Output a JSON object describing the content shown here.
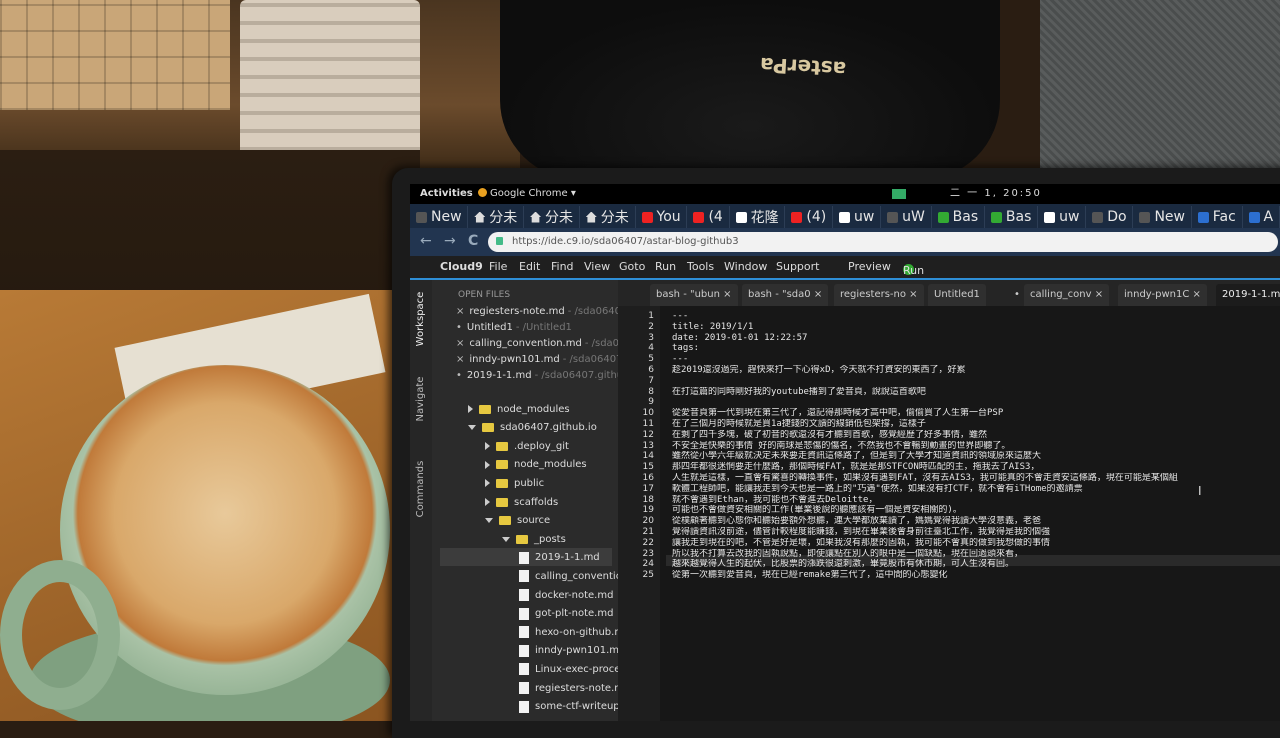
{
  "topbar": {
    "activities": "Activities",
    "app": "Google Chrome ▾",
    "clock": "二 一  1, 20:50"
  },
  "bag_logo": "asterPa",
  "browser_tabs": [
    {
      "icon": "doc-icon",
      "label": "New"
    },
    {
      "icon": "home-icon",
      "label": "分未"
    },
    {
      "icon": "home-icon",
      "label": "分未"
    },
    {
      "icon": "home-icon",
      "label": "分未"
    },
    {
      "icon": "youtube-icon",
      "label": "You"
    },
    {
      "icon": "youtube-icon",
      "label": "(4"
    },
    {
      "icon": "chrome-icon",
      "label": "花隆"
    },
    {
      "icon": "youtube-icon",
      "label": "(4)"
    },
    {
      "icon": "chrome-icon",
      "label": "uw"
    },
    {
      "icon": "doc-icon",
      "label": "uW"
    },
    {
      "icon": "sheet-icon",
      "label": "Bas"
    },
    {
      "icon": "sheet-icon",
      "label": "Bas"
    },
    {
      "icon": "chrome-icon",
      "label": "uw"
    },
    {
      "icon": "doc-icon",
      "label": "Do"
    },
    {
      "icon": "doc-icon",
      "label": "New"
    },
    {
      "icon": "facebook-icon",
      "label": "Fac"
    },
    {
      "icon": "blue-icon",
      "label": "A"
    }
  ],
  "address": {
    "back": "←",
    "forward": "→",
    "reload": "C",
    "url": "https://ide.c9.io/sda06407/astar-blog-github3"
  },
  "c9menu": {
    "logo": "Cloud9",
    "items": [
      "File",
      "Edit",
      "Find",
      "View",
      "Goto",
      "Run",
      "Tools",
      "Window",
      "Support"
    ],
    "preview": "Preview",
    "run": "Run"
  },
  "side_tabs": [
    "Workspace",
    "Navigate",
    "Commands"
  ],
  "open_files": {
    "header": "OPEN FILES",
    "files": [
      {
        "mark": "×",
        "name": "regiesters-note.md",
        "path": "- /sda06407.g"
      },
      {
        "mark": "•",
        "name": "Untitled1",
        "path": "- /Untitled1"
      },
      {
        "mark": "×",
        "name": "calling_convention.md",
        "path": "- /sda064"
      },
      {
        "mark": "×",
        "name": "inndy-pwn101.md",
        "path": "- /sda06407.gi"
      },
      {
        "mark": "•",
        "name": "2019-1-1.md",
        "path": "- /sda06407.github."
      }
    ]
  },
  "tree": [
    {
      "kind": "folder",
      "arrow": "right",
      "indent": 0,
      "name": "node_modules"
    },
    {
      "kind": "folder",
      "arrow": "down",
      "indent": 0,
      "name": "sda06407.github.io"
    },
    {
      "kind": "folder",
      "arrow": "right",
      "indent": 1,
      "name": ".deploy_git"
    },
    {
      "kind": "folder",
      "arrow": "right",
      "indent": 1,
      "name": "node_modules"
    },
    {
      "kind": "folder",
      "arrow": "right",
      "indent": 1,
      "name": "public"
    },
    {
      "kind": "folder",
      "arrow": "right",
      "indent": 1,
      "name": "scaffolds"
    },
    {
      "kind": "folder",
      "arrow": "down",
      "indent": 1,
      "name": "source"
    },
    {
      "kind": "folder",
      "arrow": "down",
      "indent": 2,
      "name": "_posts"
    },
    {
      "kind": "file",
      "arrow": "none",
      "indent": 3,
      "name": "2019-1-1.md"
    },
    {
      "kind": "file",
      "arrow": "none",
      "indent": 3,
      "name": "calling_conventic"
    },
    {
      "kind": "file",
      "arrow": "none",
      "indent": 3,
      "name": "docker-note.md"
    },
    {
      "kind": "file",
      "arrow": "none",
      "indent": 3,
      "name": "got-plt-note.md"
    },
    {
      "kind": "file",
      "arrow": "none",
      "indent": 3,
      "name": "hexo-on-github.m"
    },
    {
      "kind": "file",
      "arrow": "none",
      "indent": 3,
      "name": "inndy-pwn101.md"
    },
    {
      "kind": "file",
      "arrow": "none",
      "indent": 3,
      "name": "Linux-exec-proce"
    },
    {
      "kind": "file",
      "arrow": "none",
      "indent": 3,
      "name": "regiesters-note.m"
    },
    {
      "kind": "file",
      "arrow": "none",
      "indent": 3,
      "name": "some-ctf-writeup."
    }
  ],
  "editor_tabs": [
    {
      "label": "bash - \"ubun ×",
      "active": false
    },
    {
      "label": "bash - \"sda0 ×",
      "active": false
    },
    {
      "label": "regiesters-no ×",
      "active": false
    },
    {
      "label": "Untitled1",
      "active": false
    },
    {
      "label": "•",
      "active": false
    },
    {
      "label": "calling_conv ×",
      "active": false
    },
    {
      "label": "inndy-pwn1C ×",
      "active": false
    },
    {
      "label": "2019-1-1.m",
      "active": true
    }
  ],
  "line_numbers": [
    "1",
    "2",
    "3",
    "4",
    "5",
    "6",
    "7",
    "8",
    "9",
    "10",
    "11",
    "12",
    "13",
    "14",
    "15",
    "16",
    "17",
    "18",
    "19",
    "20",
    "21",
    "22",
    "23",
    "24",
    "25"
  ],
  "code_lines": [
    "---",
    "title: 2019/1/1",
    "date: 2019-01-01 12:22:57",
    "tags:",
    "---",
    "趁2019還沒過完，趕快來打一下心得xD，今天就不打資安的東西了，好累",
    "",
    "在打這篇的同時剛好我的youtube播到了愛音頁，說說這首歌吧",
    "",
    "從愛音頁第一代到現在第三代了，還記得那時候才高中吧，偷偷買了人生第一台PSP",
    "在了三個月的時候就是買1a捷錢的文讀的線銷低包架撐，這樣子",
    "在剩了四千多塊，破了初音的歌還沒有才聽到首歌，感覺經歷了好多事情，雖然",
    "不安全是快樂的事情      好的南球是悲傷的傷名，不然我也不會暢到動畫的世界即聽了。",
    "雖然從小學六年級就決定未來要走資訊這條路了，但是到了大學才知道資訊的領域原來這麼大",
    "那四年都很迷惘要走什麼路，那個時候FAT，就是是那STFCON時匹配的主，拖我去了AIS3，",
    "人生就是這樣，一直會有驚喜的轉換事件，如果沒有遇到FAT，沒有去AIS3，我可能真的不會走資安這條路，現在可能是某個組",
    "軟體工程師吧，能讓我走到今天也是一路上的\"巧遇\"使然，如果沒有打CTF，就不會有iTHome的邀請票",
    "就不會遇到Ethan，我可能也不會進去Deloitte，",
    "可能也不會做資安相關的工作(畢業後說的聽應該有一個是資安相關的)。",
    "從樸顧著聽到心態你和聽始要額外想聽，連大學都放棄讀了，媽媽覺得我讀大學沒意義，老爸",
    "覺得讀資訊沒前途，儘管計較程度能賺錢，到現在畢業後會身前往臺北工作，我覺得是我的個強",
    "讓我走到現在的吧，不管是好是壞，如果我沒有那麼的固執，我可能不會真的做到我想做的事情",
    "所以我不打算去改我的固執說點，即使讓點在別人的眼中是一個缺點，現在回過頭來看，",
    "越來越覺得人生的起伏，比股票的漲跌很還刺激，畢竟股市有休市期，可人生沒有回。",
    "從第一次聽到愛音頁，現在已經remake第三代了，這中間的心態變化"
  ]
}
